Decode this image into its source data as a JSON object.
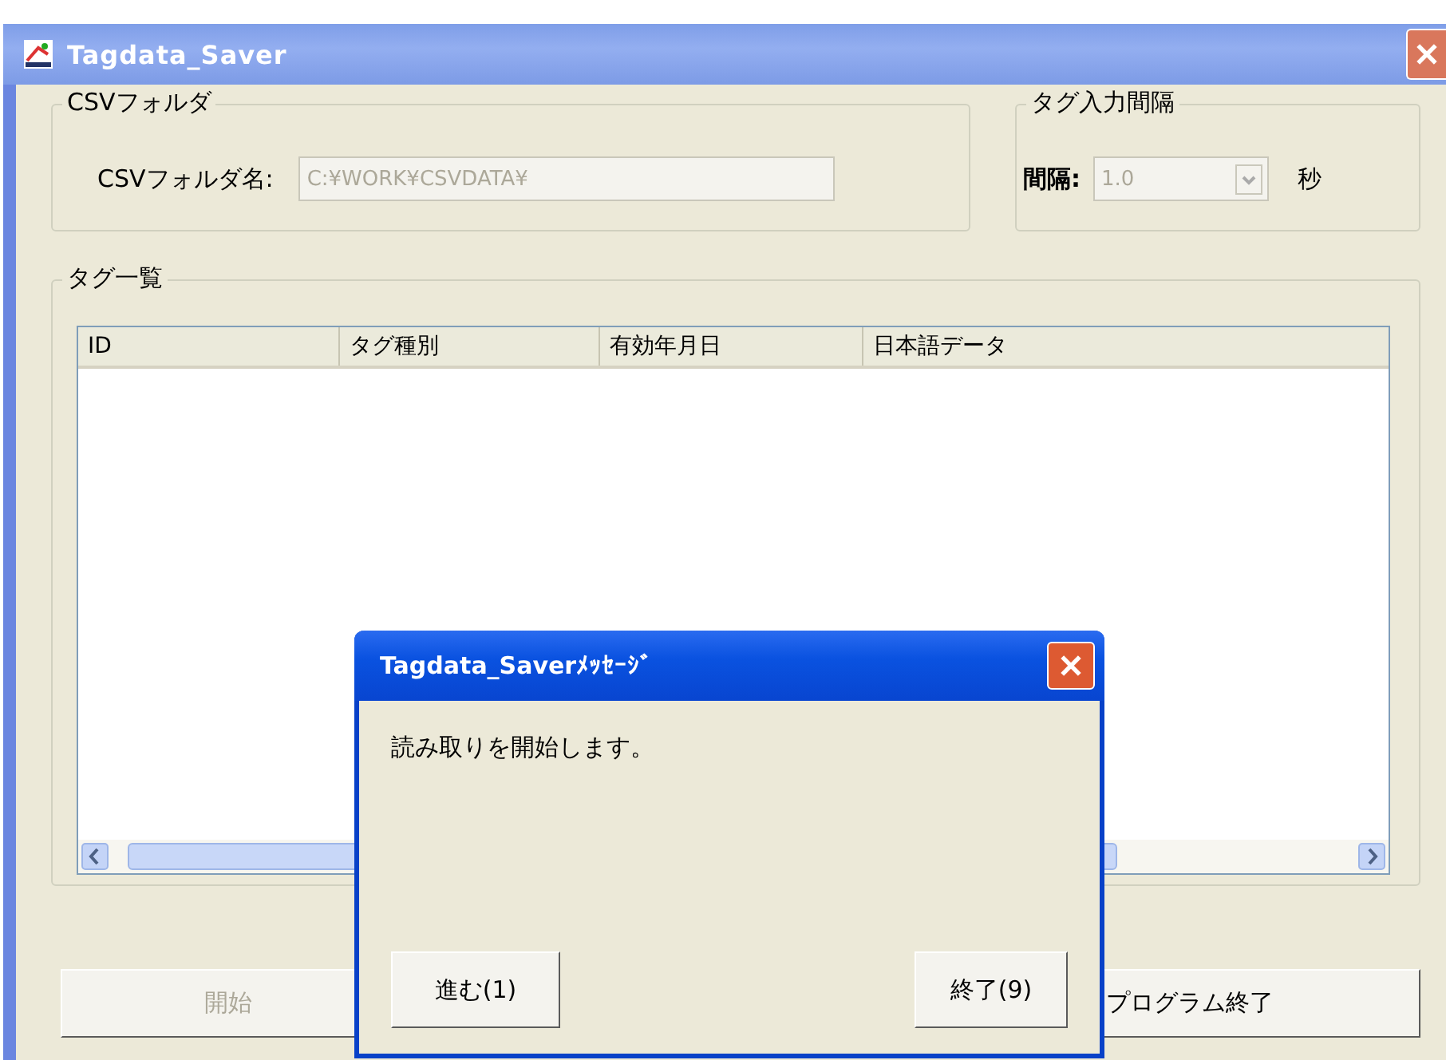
{
  "window": {
    "title": "Tagdata_Saver"
  },
  "csv_folder": {
    "legend": "CSVフォルダ",
    "label": "CSVフォルダ名:",
    "value": "C:¥WORK¥CSVDATA¥",
    "disabled": true
  },
  "interval": {
    "legend": "タグ入力間隔",
    "label": "間隔:",
    "value": "1.0",
    "disabled": true,
    "unit": "秒"
  },
  "tag_list": {
    "legend": "タグ一覧",
    "columns": [
      "ID",
      "タグ種別",
      "有効年月日",
      "日本語データ"
    ]
  },
  "buttons": [
    {
      "label": "開始",
      "disabled": true
    },
    {
      "label": "プログラム終了",
      "disabled": false
    }
  ],
  "dialog": {
    "title": "Tagdata_Saverﾒｯｾｰｼﾞ",
    "message": "読み取りを開始します。",
    "buttons": [
      "進む(1)",
      "終了(9)"
    ]
  }
}
